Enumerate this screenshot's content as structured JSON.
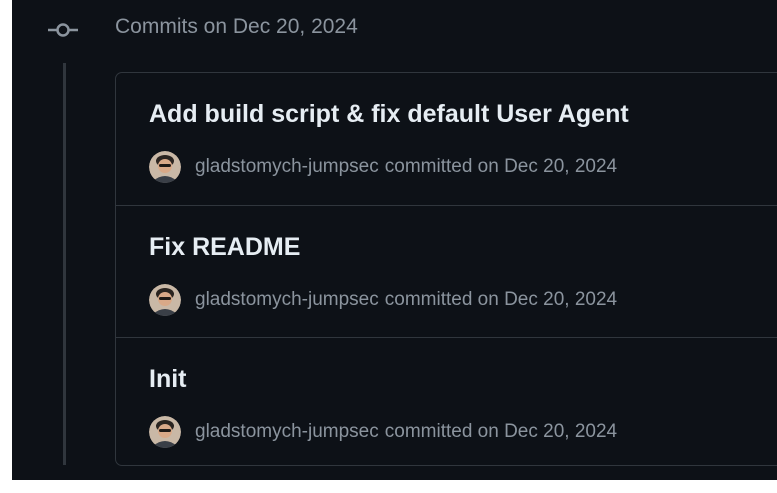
{
  "group": {
    "title": "Commits on Dec 20, 2024",
    "icon": "git-commit-icon"
  },
  "commits": [
    {
      "title": "Add build script & fix default User Agent",
      "author": "gladstomych-jumpsec",
      "committed": "committed on Dec 20, 2024",
      "avatar_icon": "avatar-icon"
    },
    {
      "title": "Fix README",
      "author": "gladstomych-jumpsec",
      "committed": "committed on Dec 20, 2024",
      "avatar_icon": "avatar-icon"
    },
    {
      "title": "Init",
      "author": "gladstomych-jumpsec",
      "committed": "committed on Dec 20, 2024",
      "avatar_icon": "avatar-icon"
    }
  ],
  "colors": {
    "background": "#0d1117",
    "border": "#30363d",
    "title_text": "#e6edf3",
    "muted_text": "#8b949e"
  }
}
